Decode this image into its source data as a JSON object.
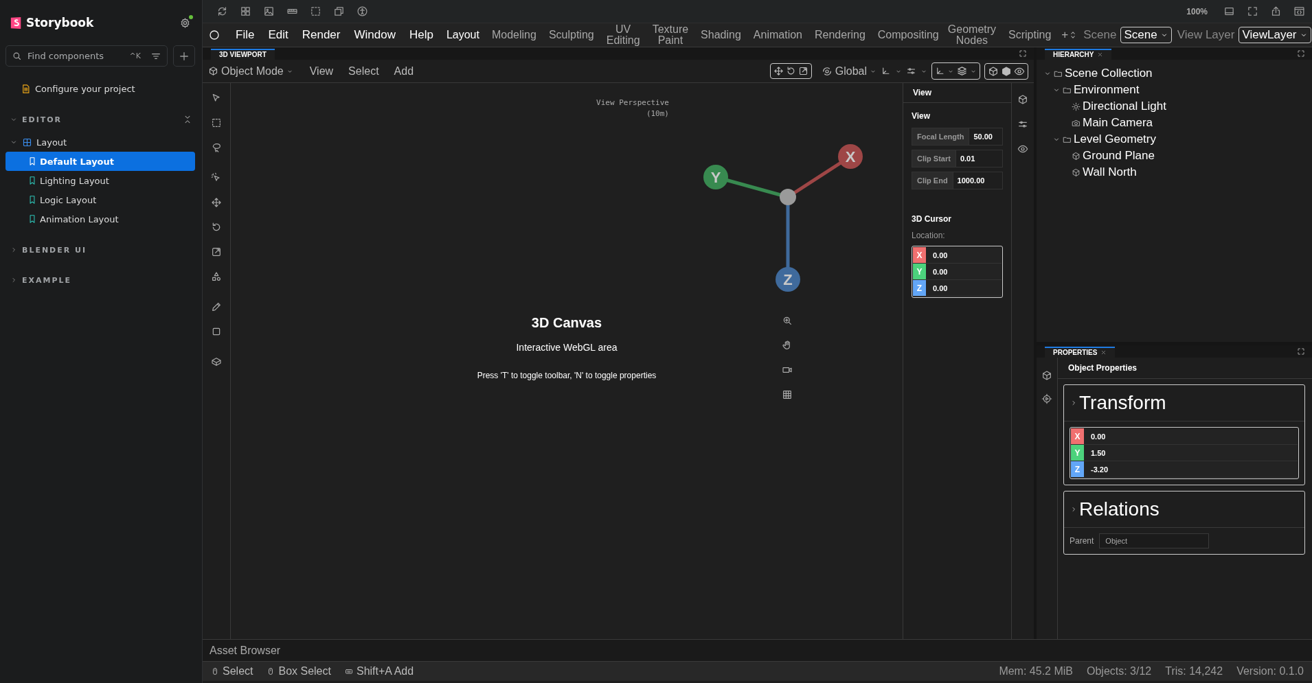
{
  "sidebar": {
    "brand": "Storybook",
    "search": {
      "placeholder": "Find components",
      "shortcut": "^K"
    },
    "configure": "Configure your project",
    "groups": [
      {
        "label": "EDITOR",
        "expanded": true,
        "items": [
          {
            "label": "Layout",
            "expanded": true,
            "children": [
              {
                "label": "Default Layout",
                "selected": true
              },
              {
                "label": "Lighting Layout",
                "selected": false
              },
              {
                "label": "Logic Layout",
                "selected": false
              },
              {
                "label": "Animation Layout",
                "selected": false
              }
            ]
          }
        ]
      },
      {
        "label": "BLENDER UI",
        "expanded": false
      },
      {
        "label": "EXAMPLE",
        "expanded": false
      }
    ]
  },
  "toolbar": {
    "zoom": "100%"
  },
  "menubar": {
    "menus": [
      "File",
      "Edit",
      "Render",
      "Window",
      "Help"
    ],
    "workspaces": [
      {
        "label": "Layout",
        "selected": true
      },
      {
        "label": "Modeling",
        "selected": false
      },
      {
        "label": "Sculpting",
        "selected": false
      },
      {
        "label": "UV Editing",
        "selected": false
      },
      {
        "label": "Texture Paint",
        "selected": false
      },
      {
        "label": "Shading",
        "selected": false
      },
      {
        "label": "Animation",
        "selected": false
      },
      {
        "label": "Rendering",
        "selected": false
      },
      {
        "label": "Compositing",
        "selected": false
      },
      {
        "label": "Geometry Nodes",
        "selected": false
      },
      {
        "label": "Scripting",
        "selected": false
      }
    ],
    "add": "+",
    "scene_label": "Scene",
    "scene": "Scene",
    "view_layer_label": "View Layer",
    "view_layer": "ViewLayer"
  },
  "viewport": {
    "tab": "3D VIEWPORT",
    "mode": "Object Mode",
    "menus": [
      "View",
      "Select",
      "Add"
    ],
    "orientation": "Global",
    "perspective": "View Perspective",
    "scale": "(10m)",
    "canvas": {
      "title": "3D Canvas",
      "subtitle": "Interactive WebGL area",
      "hint": "Press 'T' to toggle toolbar, 'N' to toggle properties"
    },
    "gizmo": [
      {
        "label": "X",
        "color": "#9e4646"
      },
      {
        "label": "Y",
        "color": "#388a50"
      },
      {
        "label": "Z",
        "color": "#3f6a9c"
      }
    ]
  },
  "npanel": {
    "tab": "View",
    "section": "View",
    "fields": [
      {
        "label": "Focal Length",
        "value": "50.00"
      },
      {
        "label": "Clip Start",
        "value": "0.01"
      },
      {
        "label": "Clip End",
        "value": "1000.00"
      }
    ],
    "cursor_title": "3D Cursor",
    "location_label": "Location:",
    "location": [
      {
        "axis": "X",
        "value": "0.00",
        "color": "#f07070"
      },
      {
        "axis": "Y",
        "value": "0.00",
        "color": "#4cd27c"
      },
      {
        "axis": "Z",
        "value": "0.00",
        "color": "#62a6f7"
      }
    ]
  },
  "hierarchy": {
    "tab": "HIERARCHY",
    "tree": [
      {
        "label": "Scene Collection",
        "kind": "folder",
        "expanded": true,
        "children": [
          {
            "label": "Environment",
            "kind": "folder",
            "expanded": true,
            "children": [
              {
                "label": "Directional Light",
                "kind": "light"
              },
              {
                "label": "Main Camera",
                "kind": "camera"
              }
            ]
          },
          {
            "label": "Level Geometry",
            "kind": "folder",
            "expanded": true,
            "children": [
              {
                "label": "Ground Plane",
                "kind": "mesh"
              },
              {
                "label": "Wall North",
                "kind": "mesh"
              }
            ]
          }
        ]
      }
    ]
  },
  "properties": {
    "tab": "PROPERTIES",
    "title": "Object Properties",
    "sections": [
      {
        "title": "Transform",
        "kind": "vector",
        "values": [
          {
            "axis": "X",
            "value": "0.00",
            "color": "#f07070"
          },
          {
            "axis": "Y",
            "value": "1.50",
            "color": "#4cd27c"
          },
          {
            "axis": "Z",
            "value": "-3.20",
            "color": "#62a6f7"
          }
        ]
      },
      {
        "title": "Relations",
        "kind": "field",
        "label": "Parent",
        "placeholder": "Object"
      }
    ]
  },
  "asset_browser": "Asset Browser",
  "status_bar": {
    "hints": [
      {
        "label": "Select",
        "kind": "mouse"
      },
      {
        "label": "Box Select",
        "kind": "mouse"
      },
      {
        "label": "Shift+A Add",
        "kind": "key"
      }
    ],
    "stats": [
      "Mem: 45.2 MiB",
      "Objects: 3/12",
      "Tris: 14,242",
      "Version: 0.1.0"
    ]
  }
}
